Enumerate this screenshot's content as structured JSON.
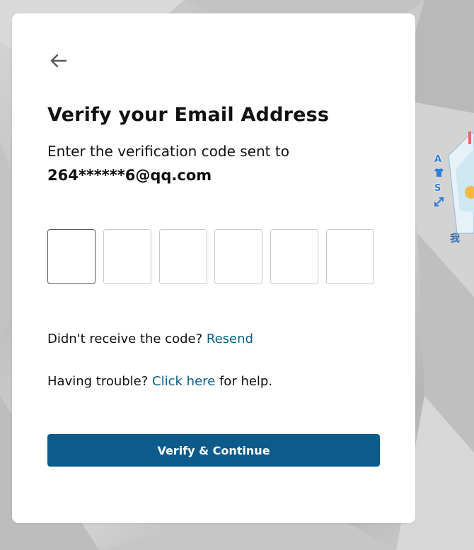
{
  "header": {
    "back_icon": "arrow-left-icon"
  },
  "form": {
    "title": "Verify your Email Address",
    "subtitle": "Enter the verification code sent to",
    "email": "264******6@qq.com",
    "code_length": 6,
    "code_values": [
      "",
      "",
      "",
      "",
      "",
      ""
    ],
    "resend_prompt": "Didn't receive the code?",
    "resend_link": "Resend",
    "help_prefix": "Having trouble?",
    "help_link": "Click here",
    "help_suffix": "for help.",
    "submit_label": "Verify & Continue"
  },
  "side_widget": {
    "letters": [
      "A",
      "S"
    ]
  },
  "colors": {
    "primary_button": "#0c5b8a",
    "link": "#0d5c86",
    "card_bg": "#ffffff",
    "page_bg": "#c9c9c9"
  }
}
